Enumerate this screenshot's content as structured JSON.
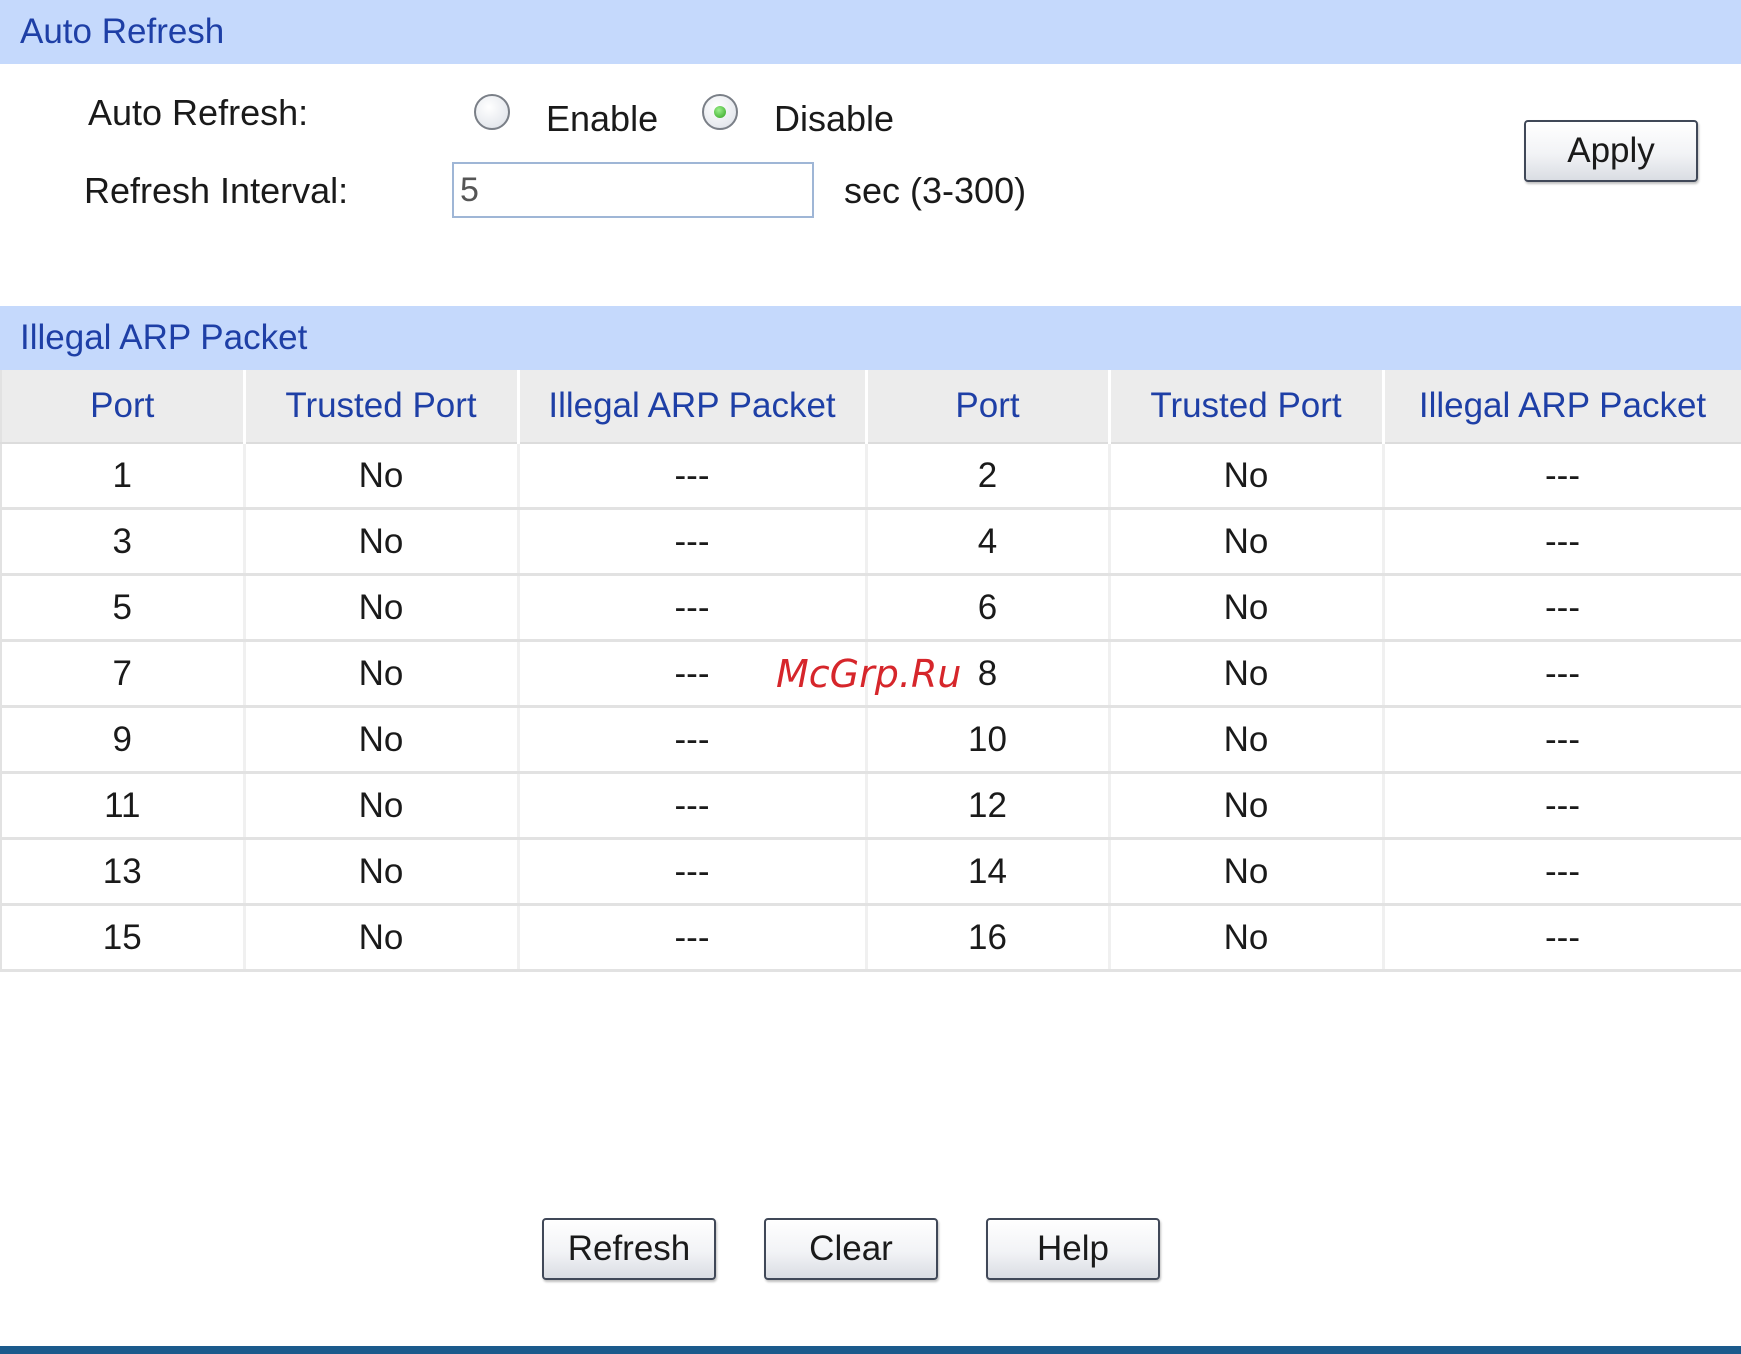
{
  "auto_refresh_section": {
    "header": "Auto Refresh",
    "auto_refresh_label": "Auto Refresh:",
    "enable_label": "Enable",
    "disable_label": "Disable",
    "selected": "Disable",
    "interval_label": "Refresh Interval:",
    "interval_value": "5",
    "interval_unit": "sec (3-300)",
    "apply_label": "Apply"
  },
  "illegal_arp_section": {
    "header": "Illegal ARP Packet",
    "columns": [
      "Port",
      "Trusted Port",
      "Illegal ARP Packet",
      "Port",
      "Trusted Port",
      "Illegal ARP Packet"
    ],
    "rows": [
      [
        "1",
        "No",
        "---",
        "2",
        "No",
        "---"
      ],
      [
        "3",
        "No",
        "---",
        "4",
        "No",
        "---"
      ],
      [
        "5",
        "No",
        "---",
        "6",
        "No",
        "---"
      ],
      [
        "7",
        "No",
        "---",
        "8",
        "No",
        "---"
      ],
      [
        "9",
        "No",
        "---",
        "10",
        "No",
        "---"
      ],
      [
        "11",
        "No",
        "---",
        "12",
        "No",
        "---"
      ],
      [
        "13",
        "No",
        "---",
        "14",
        "No",
        "---"
      ],
      [
        "15",
        "No",
        "---",
        "16",
        "No",
        "---"
      ]
    ]
  },
  "actions": {
    "refresh_label": "Refresh",
    "clear_label": "Clear",
    "help_label": "Help"
  },
  "watermark": "McGrp.Ru",
  "colors": {
    "section_header_bg": "#c5d9fc",
    "header_text": "#1e3fa6",
    "bottom_bar": "#1b5a8c",
    "watermark": "#d6262b"
  }
}
